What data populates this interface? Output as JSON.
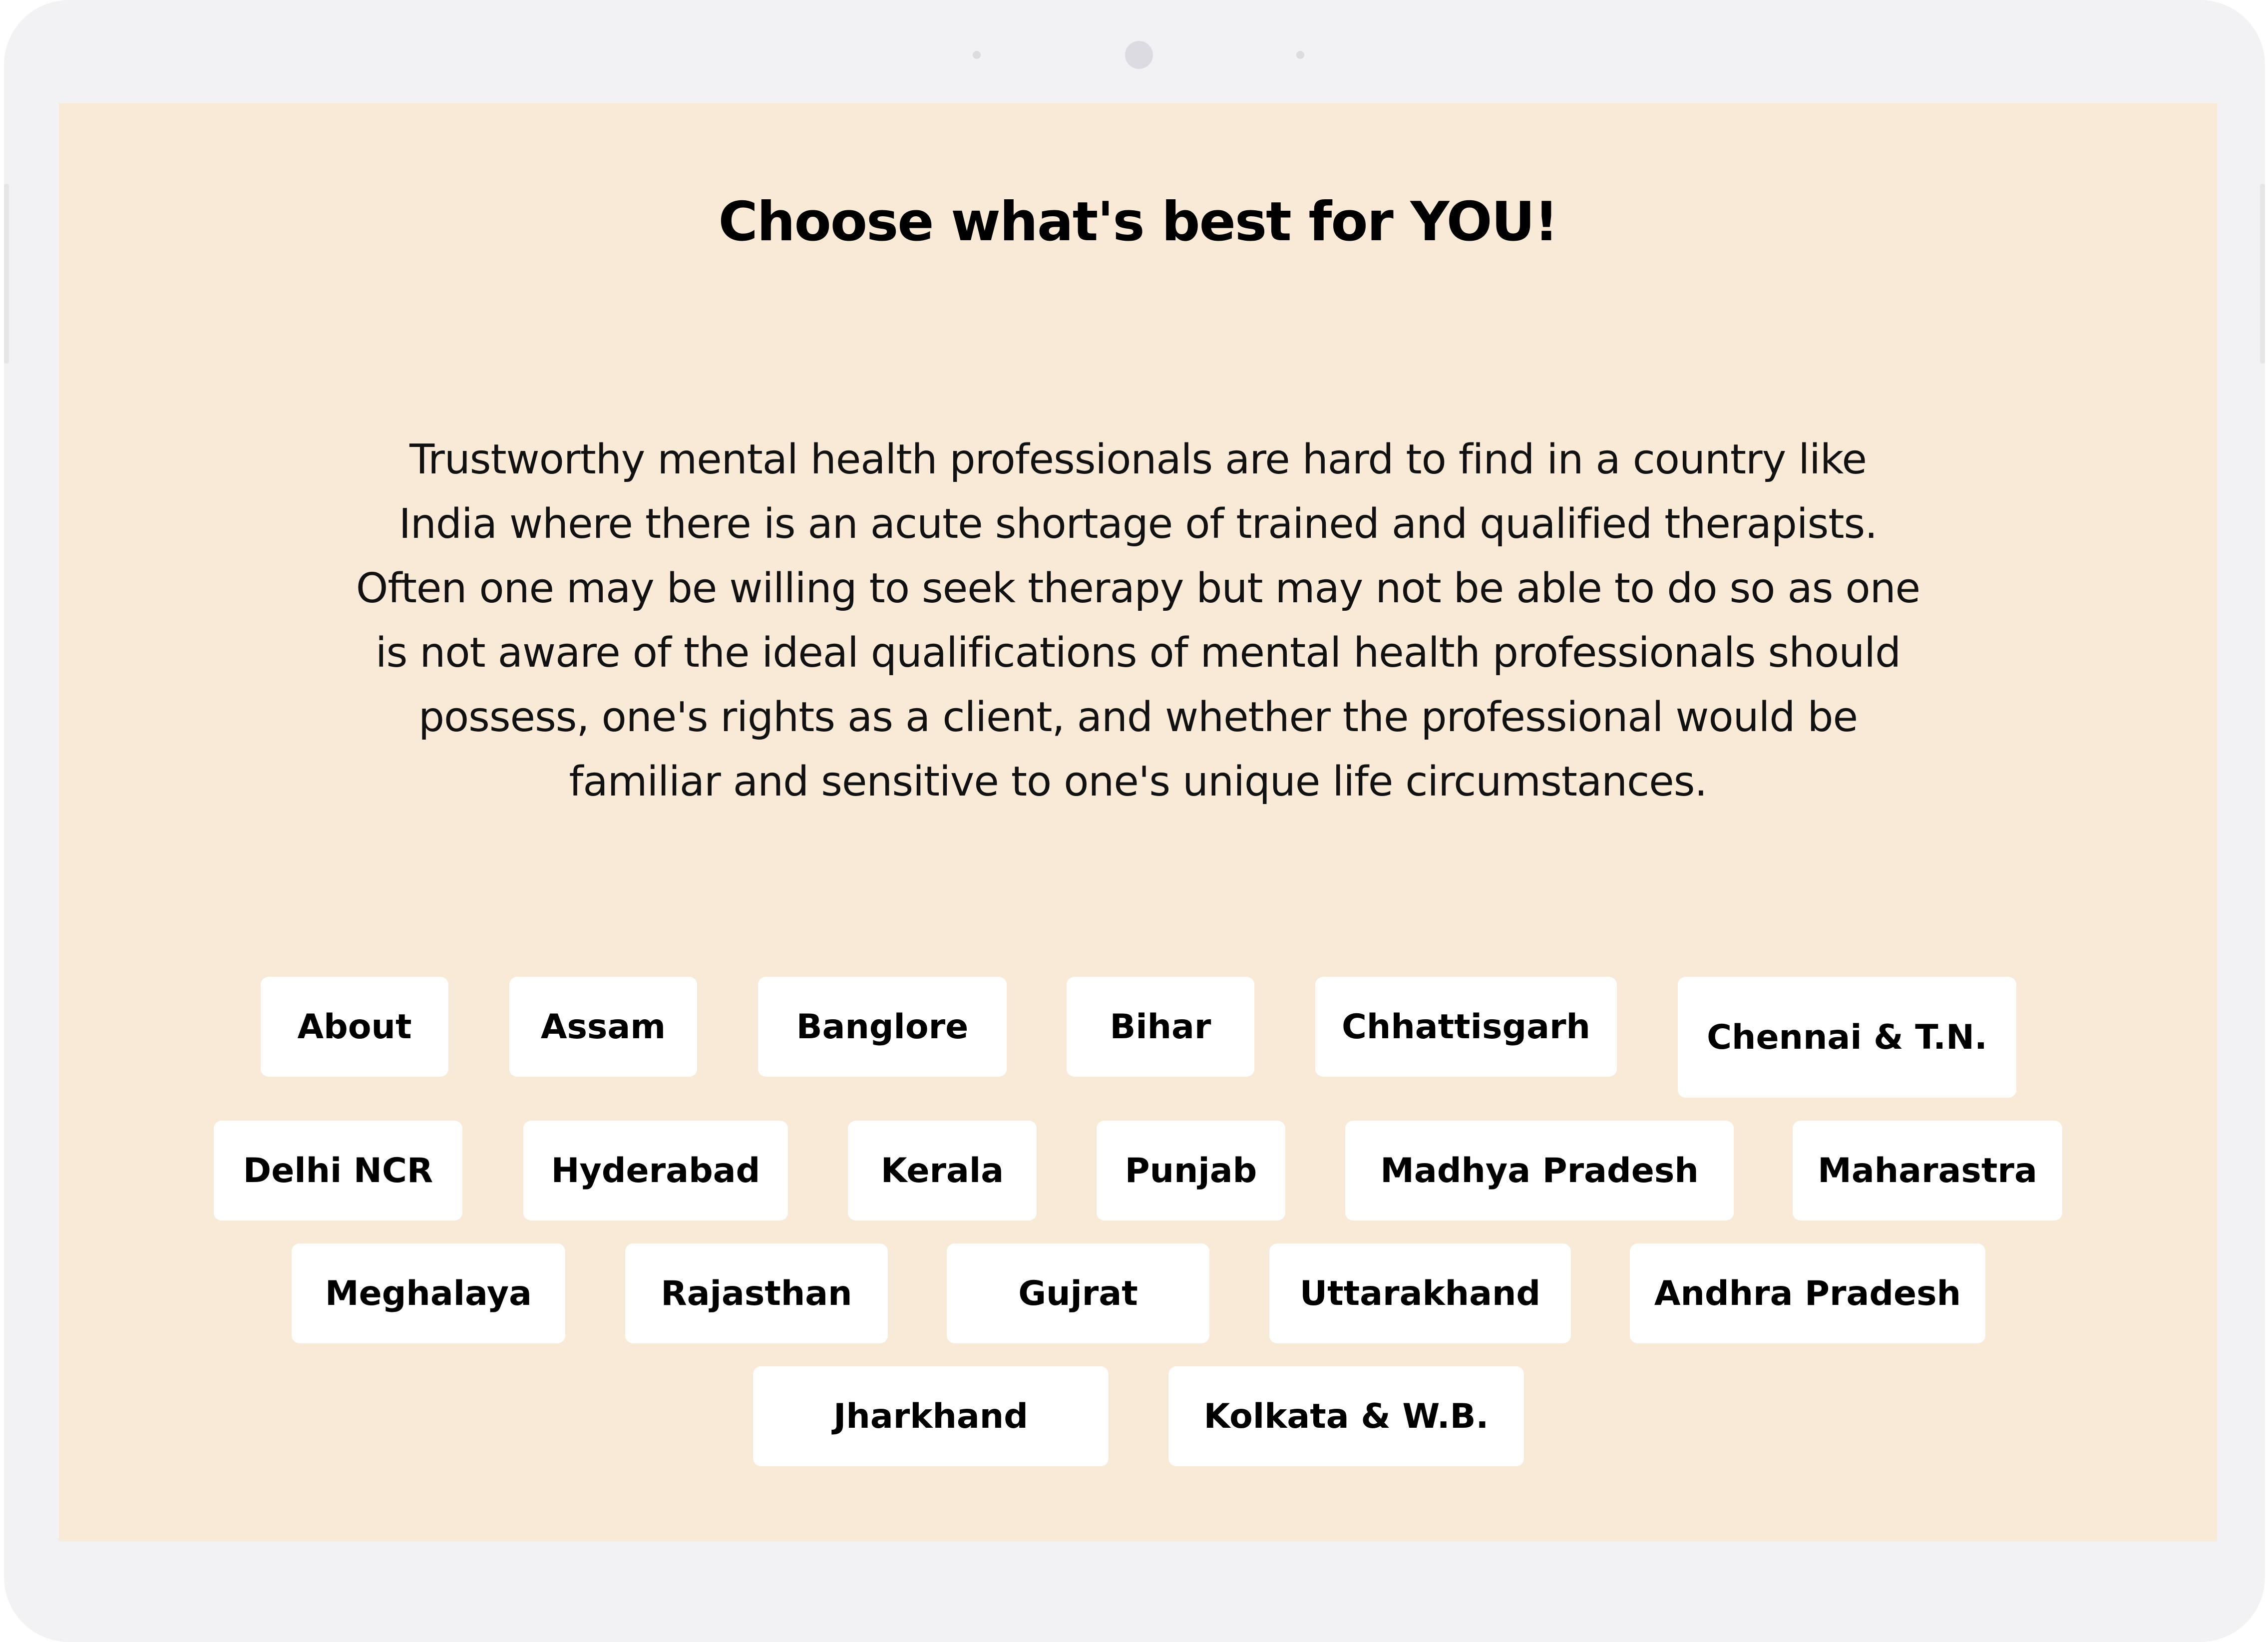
{
  "heading": "Choose what's best for YOU!",
  "intro_lines": [
    "Trustworthy mental health professionals are hard to find in a country like",
    "India where there is an acute shortage of trained and qualified therapists.",
    "Often one may be willing to seek therapy but may not be able to do so as one",
    "is not aware of the ideal qualifications of mental health professionals should",
    "possess, one's rights as a client, and whether the professional would be",
    "familiar and sensitive to one's unique life circumstances."
  ],
  "regions": [
    "About",
    "Assam",
    "Banglore",
    "Bihar",
    "Chhattisgarh",
    "Chennai & T.N.",
    "Delhi NCR",
    "Hyderabad",
    "Kerala",
    "Punjab",
    "Madhya Pradesh",
    "Maharastra",
    "Meghalaya",
    "Rajasthan",
    "Gujrat",
    "Uttarakhand",
    "Andhra Pradesh",
    "Jharkhand",
    "Kolkata & W.B."
  ],
  "colors": {
    "screen_background": "#f9ead8",
    "device_frame": "#f2f2f4",
    "chip_background": "#ffffff",
    "text": "#000000"
  }
}
